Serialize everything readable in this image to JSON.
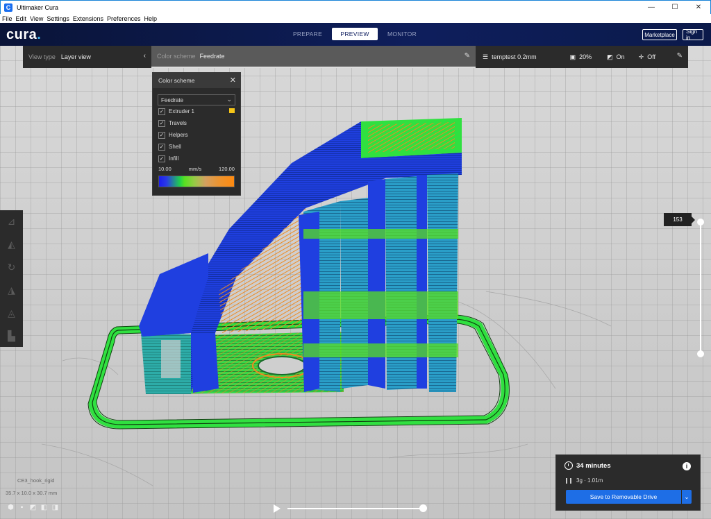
{
  "window": {
    "title": "Ultimaker Cura",
    "app_icon_letter": "C",
    "controls": {
      "minimize": "—",
      "maximize": "☐",
      "close": "✕"
    }
  },
  "menubar": [
    "File",
    "Edit",
    "View",
    "Settings",
    "Extensions",
    "Preferences",
    "Help"
  ],
  "header": {
    "logo": "cura",
    "logo_dot": ".",
    "stages": [
      "PREPARE",
      "PREVIEW",
      "MONITOR"
    ],
    "active_stage": "PREVIEW",
    "marketplace": "Marketplace",
    "signin": "Sign in"
  },
  "topbar": {
    "view_type_label": "View type",
    "view_type_value": "Layer view",
    "color_scheme_label": "Color scheme",
    "color_scheme_value": "Feedrate",
    "profile": "temptest 0.2mm",
    "infill": "20%",
    "support": "On",
    "adhesion": "Off"
  },
  "scheme_panel": {
    "title": "Color scheme",
    "selected": "Feedrate",
    "options": [
      {
        "label": "Extruder 1",
        "checked": true,
        "swatch": "#f5c518"
      },
      {
        "label": "Travels",
        "checked": true
      },
      {
        "label": "Helpers",
        "checked": true
      },
      {
        "label": "Shell",
        "checked": true
      },
      {
        "label": "Infill",
        "checked": true
      }
    ],
    "min": "10.00",
    "unit": "mm/s",
    "max": "120.00"
  },
  "layer_slider": {
    "current": "153",
    "top_fraction": 0.0,
    "bottom_fraction": 1.0
  },
  "object": {
    "name": "CE3_hook_rigid",
    "dimensions": "35.7 x 10.0 x 30.7 mm"
  },
  "playback": {
    "progress": 1.0
  },
  "print": {
    "time": "34 minutes",
    "material": "3g · 1.01m",
    "save_button": "Save to Removable Drive"
  },
  "colors": {
    "accent": "#1e6ee6",
    "header": "#0e1e5c",
    "blue_layer": "#1f3fe0",
    "green_layer": "#30e040",
    "teal_layer": "#2a9ec8",
    "orange_layer": "#f08a20"
  }
}
